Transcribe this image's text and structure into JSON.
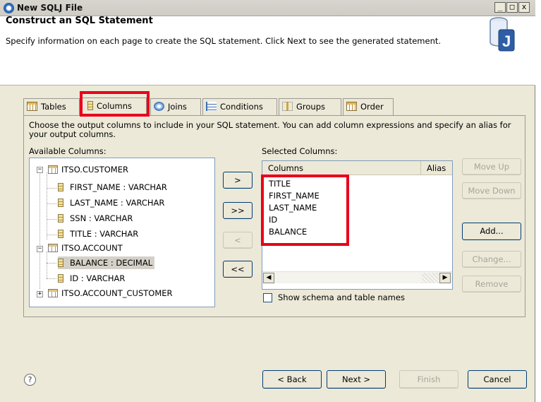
{
  "window": {
    "title": "New SQLJ File",
    "controls": [
      "_",
      "□",
      "x"
    ]
  },
  "header": {
    "title": "Construct an SQL Statement",
    "description": "Specify information on each page to create the SQL statement. Click Next to see the generated statement."
  },
  "tabs": [
    {
      "label": "Tables",
      "icon": "table-icon"
    },
    {
      "label": "Columns",
      "icon": "column-icon",
      "active": true
    },
    {
      "label": "Joins",
      "icon": "joins-icon"
    },
    {
      "label": "Conditions",
      "icon": "conditions-icon"
    },
    {
      "label": "Groups",
      "icon": "groups-icon"
    },
    {
      "label": "Order",
      "icon": "order-icon"
    }
  ],
  "page": {
    "description": "Choose the output columns to include in your SQL statement. You can add column expressions and specify an alias for your output columns.",
    "available_label": "Available Columns:",
    "selected_label": "Selected Columns:"
  },
  "tree": {
    "tables": [
      {
        "name": "ITSO.CUSTOMER",
        "expanded": true,
        "columns": [
          "FIRST_NAME : VARCHAR",
          "LAST_NAME : VARCHAR",
          "SSN : VARCHAR",
          "TITLE : VARCHAR"
        ]
      },
      {
        "name": "ITSO.ACCOUNT",
        "expanded": true,
        "columns": [
          "BALANCE : DECIMAL",
          "ID : VARCHAR"
        ],
        "selected_column": "BALANCE : DECIMAL"
      },
      {
        "name": "ITSO.ACCOUNT_CUSTOMER",
        "expanded": false,
        "columns": []
      }
    ]
  },
  "transfer_buttons": {
    "add": ">",
    "add_all": ">>",
    "remove": "<",
    "remove_all": "<<"
  },
  "selected": {
    "column_headers": [
      "Columns",
      "Alias"
    ],
    "items": [
      "TITLE",
      "FIRST_NAME",
      "LAST_NAME",
      "ID",
      "BALANCE"
    ]
  },
  "side_buttons": {
    "move_up": "Move Up",
    "move_down": "Move Down",
    "add": "Add...",
    "change": "Change...",
    "remove": "Remove"
  },
  "show_schema": {
    "label": "Show schema and table names",
    "checked": false
  },
  "footer": {
    "back": "< Back",
    "next": "Next >",
    "finish": "Finish",
    "cancel": "Cancel",
    "help": "?"
  },
  "colors": {
    "highlight": "#e8001c",
    "dialog_bg": "#ece9d8",
    "disabled_text": "#a6a59c"
  }
}
